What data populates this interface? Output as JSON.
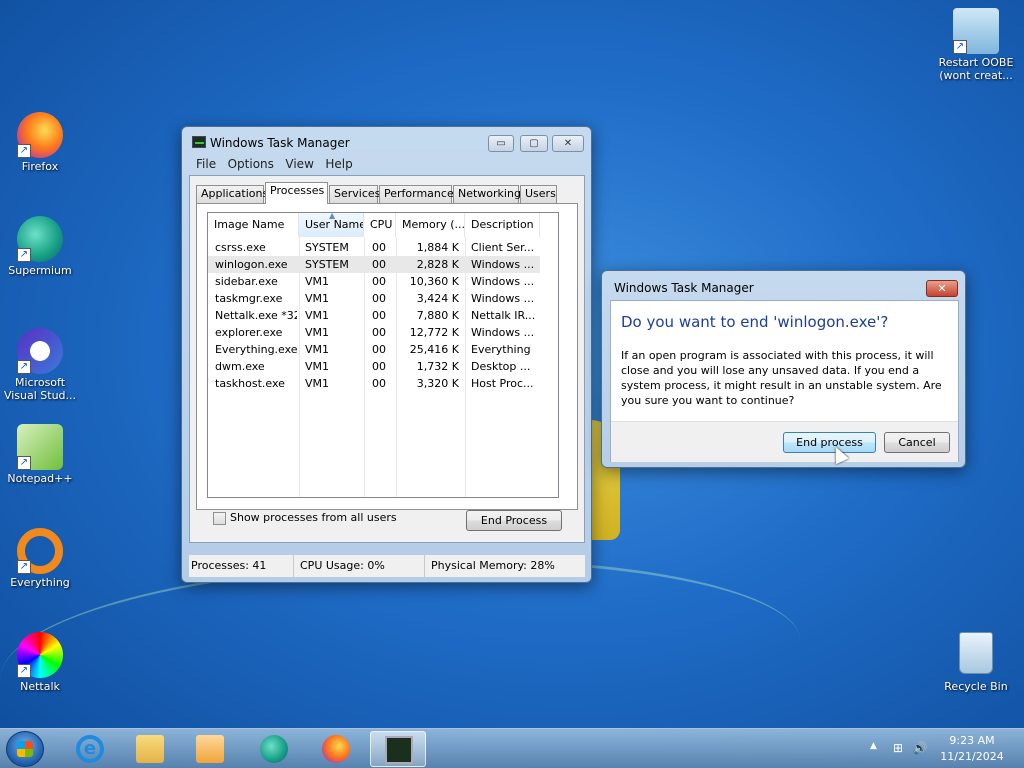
{
  "desktop": {
    "icons": [
      {
        "label": "Firefox",
        "icon": "firefox-icon"
      },
      {
        "label": "Supermium",
        "icon": "supermium-icon"
      },
      {
        "label": "Microsoft Visual Stud...",
        "icon": "visual-studio-icon"
      },
      {
        "label": "Notepad++",
        "icon": "notepad-plus-plus-icon"
      },
      {
        "label": "Everything",
        "icon": "everything-icon"
      },
      {
        "label": "Nettalk",
        "icon": "nettalk-icon"
      },
      {
        "label": "Restart OOBE (wont creat...",
        "icon": "restart-oobe-icon"
      },
      {
        "label": "Recycle Bin",
        "icon": "recycle-bin-icon"
      }
    ]
  },
  "taskmgr": {
    "title": "Windows Task Manager",
    "caption": {
      "minimize": "▭",
      "maximize": "▢",
      "close": "✕"
    },
    "menu": [
      "File",
      "Options",
      "View",
      "Help"
    ],
    "tabs": [
      "Applications",
      "Processes",
      "Services",
      "Performance",
      "Networking",
      "Users"
    ],
    "active_tab": "Processes",
    "columns": [
      "Image Name",
      "User Name",
      "CPU",
      "Memory (...",
      "Description"
    ],
    "sorted_column": "User Name",
    "rows": [
      {
        "image": "csrss.exe",
        "user": "SYSTEM",
        "cpu": "00",
        "mem": "1,884 K",
        "desc": "Client Ser..."
      },
      {
        "image": "winlogon.exe",
        "user": "SYSTEM",
        "cpu": "00",
        "mem": "2,828 K",
        "desc": "Windows ..."
      },
      {
        "image": "sidebar.exe",
        "user": "VM1",
        "cpu": "00",
        "mem": "10,360 K",
        "desc": "Windows ..."
      },
      {
        "image": "taskmgr.exe",
        "user": "VM1",
        "cpu": "00",
        "mem": "3,424 K",
        "desc": "Windows ..."
      },
      {
        "image": "Nettalk.exe *32",
        "user": "VM1",
        "cpu": "00",
        "mem": "7,880 K",
        "desc": "Nettalk IR..."
      },
      {
        "image": "explorer.exe",
        "user": "VM1",
        "cpu": "00",
        "mem": "12,772 K",
        "desc": "Windows ..."
      },
      {
        "image": "Everything.exe",
        "user": "VM1",
        "cpu": "00",
        "mem": "25,416 K",
        "desc": "Everything"
      },
      {
        "image": "dwm.exe",
        "user": "VM1",
        "cpu": "00",
        "mem": "1,732 K",
        "desc": "Desktop ..."
      },
      {
        "image": "taskhost.exe",
        "user": "VM1",
        "cpu": "00",
        "mem": "3,320 K",
        "desc": "Host Proc..."
      }
    ],
    "selected_row": "winlogon.exe",
    "show_all_label": "Show processes from all users",
    "end_process_label": "End Process",
    "status": {
      "processes": "Processes: 41",
      "cpu": "CPU Usage: 0%",
      "memory": "Physical Memory: 28%"
    }
  },
  "dialog": {
    "title": "Windows Task Manager",
    "close": "✕",
    "question": "Do you want to end 'winlogon.exe'?",
    "message": "If an open program is associated with this process, it will close and you will lose any unsaved data. If you end a system process, it might result in an unstable system. Are you sure you want to continue?",
    "end_label": "End process",
    "cancel_label": "Cancel"
  },
  "taskbar": {
    "pinned": [
      "internet-explorer-icon",
      "file-explorer-icon",
      "media-player-icon",
      "supermium-icon",
      "firefox-icon",
      "task-manager-icon"
    ],
    "active": "task-manager-icon",
    "tray": {
      "arrow": "▲",
      "network": "⊞",
      "volume": "🔊"
    },
    "time": "9:23 AM",
    "date": "11/21/2024"
  }
}
